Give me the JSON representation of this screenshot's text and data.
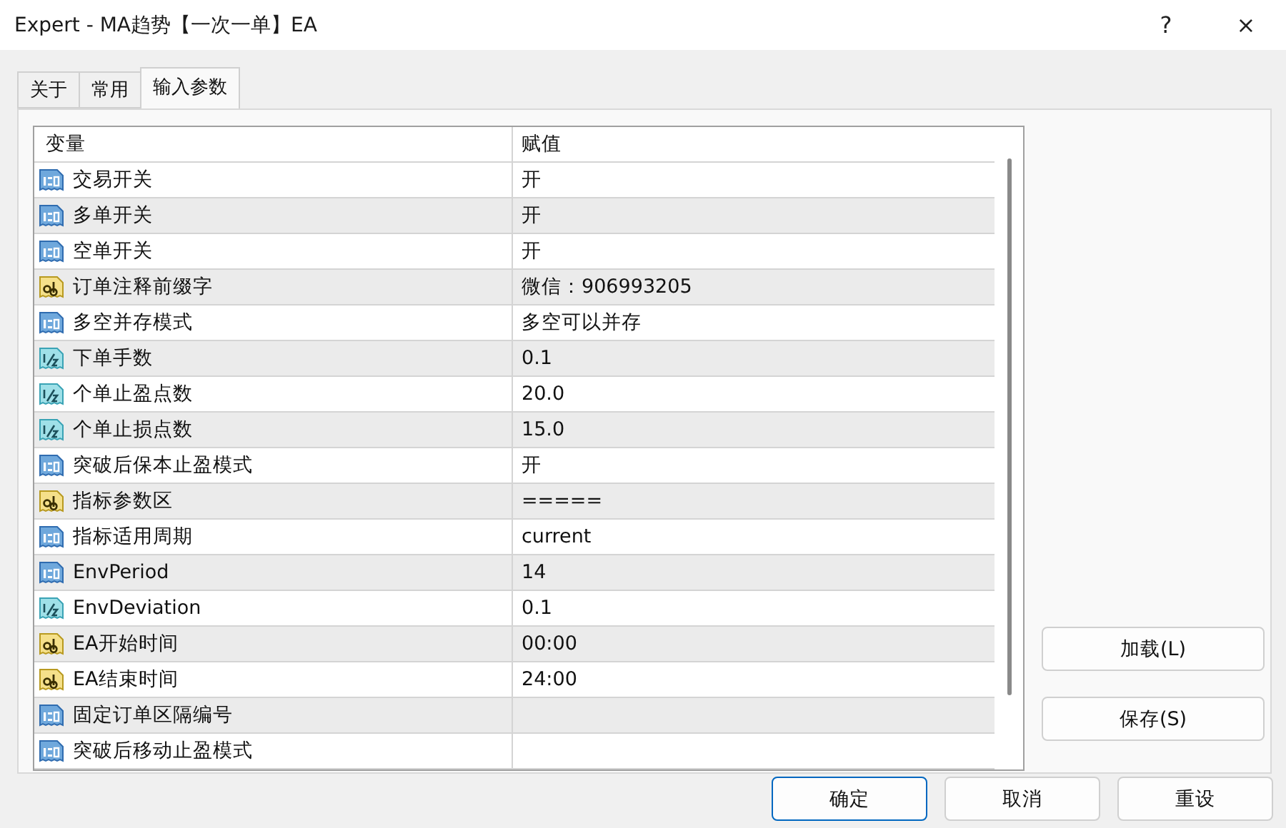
{
  "window": {
    "title": "Expert - MA趋势【一次一单】EA",
    "help": "?",
    "close": "×"
  },
  "tabs": [
    {
      "label": "关于",
      "selected": false
    },
    {
      "label": "常用",
      "selected": false
    },
    {
      "label": "输入参数",
      "selected": true
    }
  ],
  "table": {
    "columns": [
      "变量",
      "赋值"
    ],
    "rows": [
      {
        "kind": "int",
        "name": "交易开关",
        "value": "开"
      },
      {
        "kind": "int",
        "name": "多单开关",
        "value": "开"
      },
      {
        "kind": "int",
        "name": "空单开关",
        "value": "开"
      },
      {
        "kind": "text",
        "name": "订单注释前缀字",
        "value": "微信：906993205"
      },
      {
        "kind": "int",
        "name": "多空并存模式",
        "value": "多空可以并存"
      },
      {
        "kind": "double",
        "name": "下单手数",
        "value": "0.1"
      },
      {
        "kind": "double",
        "name": "个单止盈点数",
        "value": "20.0"
      },
      {
        "kind": "double",
        "name": "个单止损点数",
        "value": "15.0"
      },
      {
        "kind": "int",
        "name": "突破后保本止盈模式",
        "value": "开"
      },
      {
        "kind": "text",
        "name": "指标参数区",
        "value": "====="
      },
      {
        "kind": "int",
        "name": "指标适用周期",
        "value": "current"
      },
      {
        "kind": "int",
        "name": "EnvPeriod",
        "value": "14"
      },
      {
        "kind": "double",
        "name": "EnvDeviation",
        "value": "0.1"
      },
      {
        "kind": "text",
        "name": "EA开始时间",
        "value": "00:00"
      },
      {
        "kind": "text",
        "name": "EA结束时间",
        "value": "24:00"
      },
      {
        "kind": "int",
        "name": "固定订单区隔编号"
      },
      {
        "kind": "int",
        "name": "突破后移动止盈模式"
      }
    ]
  },
  "side_buttons": [
    "加载(L)",
    "保存(S)"
  ],
  "buttons": [
    {
      "label": "确定",
      "default": true
    },
    {
      "label": "取消",
      "default": false
    },
    {
      "label": "重设",
      "default": false
    }
  ]
}
